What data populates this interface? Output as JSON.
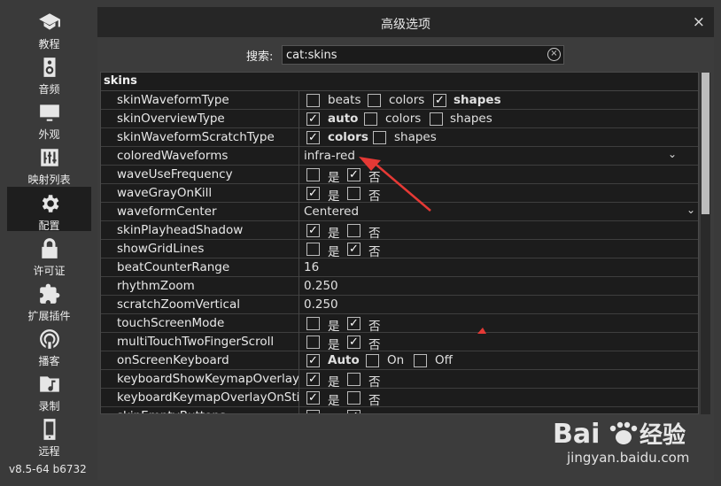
{
  "sidebar": {
    "items": [
      {
        "label": "教程",
        "icon": "graduation-cap-icon"
      },
      {
        "label": "音频",
        "icon": "speaker-icon"
      },
      {
        "label": "外观",
        "icon": "monitor-icon"
      },
      {
        "label": "映射列表",
        "icon": "sliders-icon"
      },
      {
        "label": "配置",
        "icon": "gear-icon",
        "active": true
      },
      {
        "label": "许可证",
        "icon": "lock-icon"
      },
      {
        "label": "扩展插件",
        "icon": "puzzle-icon"
      },
      {
        "label": "播客",
        "icon": "podcast-icon"
      },
      {
        "label": "录制",
        "icon": "music-folder-icon"
      },
      {
        "label": "远程",
        "icon": "phone-icon"
      }
    ],
    "version": "v8.5-64 b6732"
  },
  "dialog": {
    "title": "高级选项",
    "close": "×"
  },
  "search": {
    "label": "搜索:",
    "value": "cat:skins",
    "clear": "×"
  },
  "section": "skins",
  "rows": {
    "r0": {
      "key": "skinWaveformType",
      "o1": "beats",
      "o2": "colors",
      "o3": "shapes"
    },
    "r1": {
      "key": "skinOverviewType",
      "o1": "auto",
      "o2": "colors",
      "o3": "shapes"
    },
    "r2": {
      "key": "skinWaveformScratchType",
      "o1": "colors",
      "o2": "shapes"
    },
    "r3": {
      "key": "coloredWaveforms",
      "value": "infra-red"
    },
    "r4": {
      "key": "waveUseFrequency",
      "yes": "是",
      "no": "否"
    },
    "r5": {
      "key": "waveGrayOnKill",
      "yes": "是",
      "no": "否"
    },
    "r6": {
      "key": "waveformCenter",
      "value": "Centered"
    },
    "r7": {
      "key": "skinPlayheadShadow",
      "yes": "是",
      "no": "否"
    },
    "r8": {
      "key": "showGridLines",
      "yes": "是",
      "no": "否"
    },
    "r9": {
      "key": "beatCounterRange",
      "value": "16"
    },
    "r10": {
      "key": "rhythmZoom",
      "value": "0.250"
    },
    "r11": {
      "key": "scratchZoomVertical",
      "value": "0.250"
    },
    "r12": {
      "key": "touchScreenMode",
      "yes": "是",
      "no": "否"
    },
    "r13": {
      "key": "multiTouchTwoFingerScroll",
      "yes": "是",
      "no": "否"
    },
    "r14": {
      "key": "onScreenKeyboard",
      "o1": "Auto",
      "o2": "On",
      "o3": "Off"
    },
    "r15": {
      "key": "keyboardShowKeymapOverlay",
      "yes": "是",
      "no": "否"
    },
    "r16": {
      "key": "keyboardKeymapOverlayOnSticky",
      "yes": "是",
      "no": "否"
    },
    "r17": {
      "key": "skinEmptyButtons",
      "yes": "是",
      "no": "否"
    }
  },
  "colors": {
    "annotation_arrow": "#e53935",
    "background": "#3a3a3a",
    "table_bg": "#1c1c1c"
  },
  "watermark": {
    "logo": "Bai 经验",
    "url": "jingyan.baidu.com"
  }
}
